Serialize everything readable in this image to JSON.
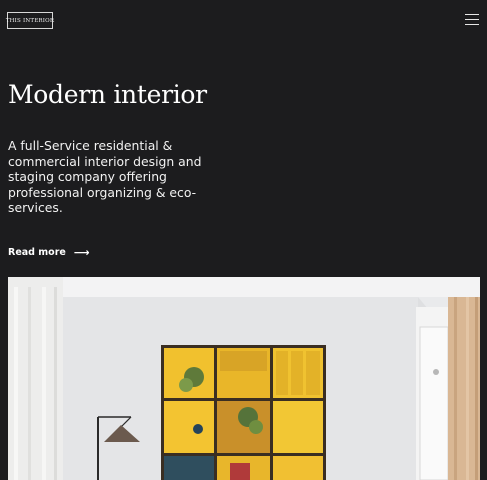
{
  "header": {
    "logo_text": "THIS INTERIOR",
    "menu_icon": "hamburger-menu-icon"
  },
  "hero": {
    "title": "Modern interior",
    "description": "A full-Service residential & commercial interior design and staging company offering professional organizing & eco-services.",
    "cta_label": "Read more",
    "cta_icon": "arrow-right-icon"
  },
  "colors": {
    "background": "#1c1c1e",
    "text": "#ffffff",
    "accent_yellow": "#f2c230"
  }
}
